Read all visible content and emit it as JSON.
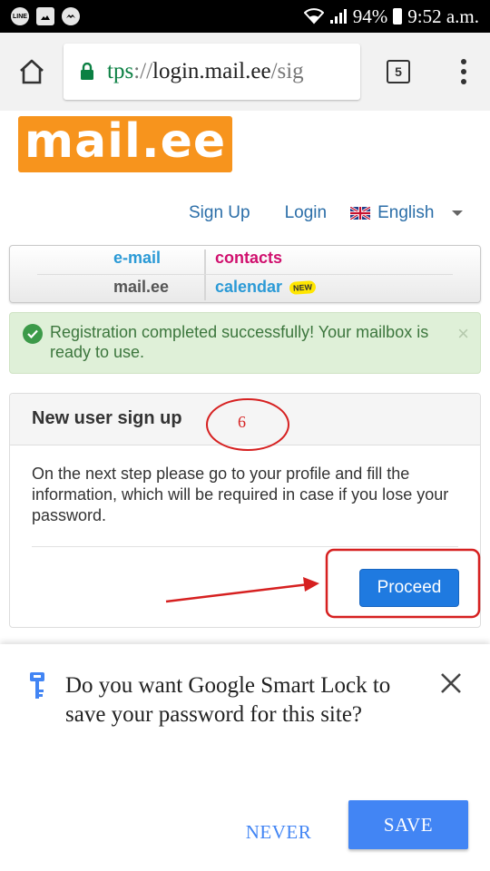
{
  "status_bar": {
    "left_icons": [
      "line-icon",
      "gallery-icon",
      "messenger-icon"
    ],
    "line_label": "LINE",
    "battery": "94%",
    "time": "9:52 a.m."
  },
  "browser": {
    "url_scheme": "tps",
    "url_sep": "://",
    "url_host": "login.mail.ee",
    "url_rest": "/sig",
    "tab_count": "5"
  },
  "site": {
    "logo_text": "mail.ee",
    "nav": {
      "signup": "Sign Up",
      "login": "Login",
      "language": "English"
    },
    "tabs": {
      "email": "e-mail",
      "contacts": "contacts",
      "mailee": "mail.ee",
      "calendar": "calendar",
      "new_badge": "NEW"
    },
    "alert": {
      "message": "Registration completed successfully! Your mailbox is ready to use.",
      "close": "×"
    },
    "panel": {
      "title": "New user sign up",
      "body": "On the next step please go to your profile and fill the information, which will be required in case if you lose your password.",
      "proceed": "Proceed"
    }
  },
  "annotation": {
    "step_number": "6",
    "color": "#d62020"
  },
  "smart_lock": {
    "prompt": "Do you want Google Smart Lock to save your password for this site?",
    "never": "NEVER",
    "save": "SAVE"
  },
  "colors": {
    "logo_orange": "#f7941d",
    "link_blue": "#2b6ea8",
    "email_blue": "#2b9ad6",
    "contacts_magenta": "#d0106e",
    "alert_green_bg": "#dff0d8",
    "alert_green_text": "#3c763d",
    "proceed_blue": "#1f7ae0",
    "google_blue": "#4285f4"
  }
}
